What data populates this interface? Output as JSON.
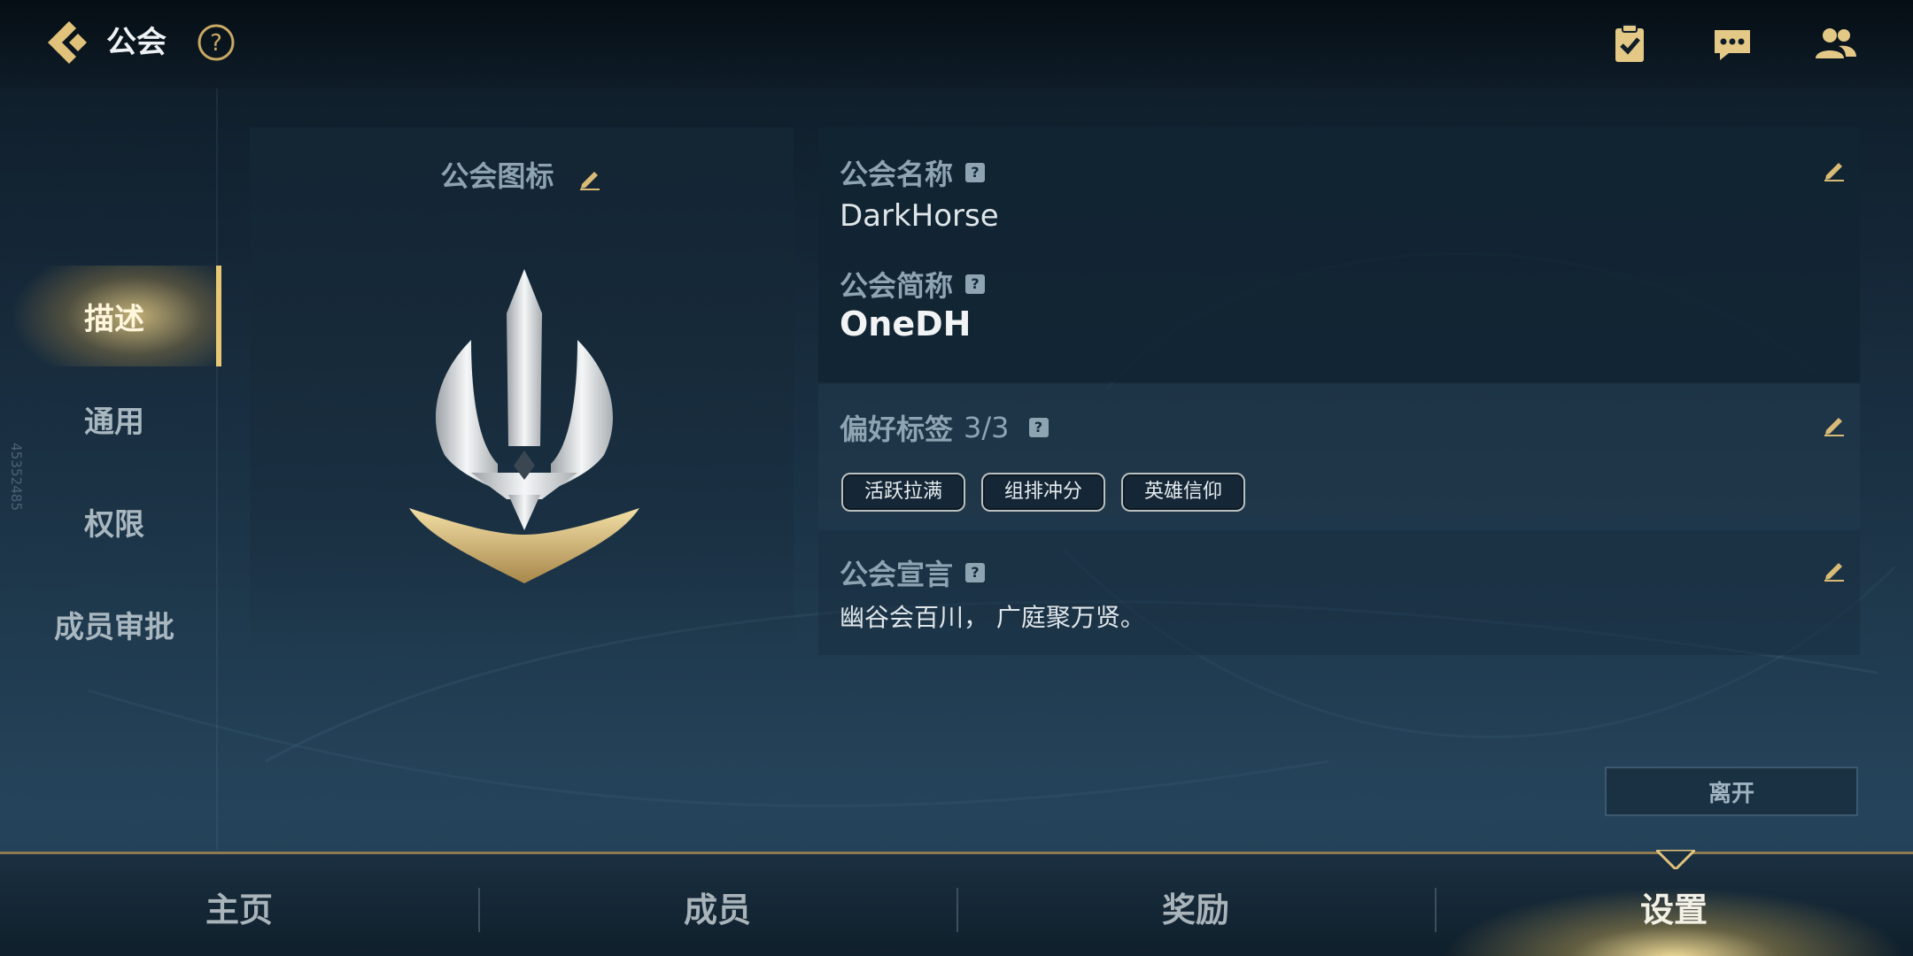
{
  "header": {
    "title": "公会",
    "icons": [
      "back-icon",
      "help-icon",
      "task-check-icon",
      "chat-icon",
      "friends-icon"
    ]
  },
  "side_nav": {
    "items": [
      {
        "label": "描述",
        "active": true
      },
      {
        "label": "通用",
        "active": false
      },
      {
        "label": "权限",
        "active": false
      },
      {
        "label": "成员审批",
        "active": false
      }
    ],
    "vertical_id": "45352485"
  },
  "emblem_panel": {
    "title": "公会图标"
  },
  "guild": {
    "name_label": "公会名称",
    "name": "DarkHorse",
    "short_label": "公会简称",
    "short_name": "OneDH",
    "tags_label": "偏好标签",
    "tags_count": "3/3",
    "tags": [
      "活跃拉满",
      "组排冲分",
      "英雄信仰"
    ],
    "motto_label": "公会宣言",
    "motto": "幽谷会百川， 广庭聚万贤。",
    "help_glyph": "?"
  },
  "actions": {
    "leave_label": "离开"
  },
  "bottom_tabs": [
    {
      "label": "主页",
      "active": false
    },
    {
      "label": "成员",
      "active": false
    },
    {
      "label": "奖励",
      "active": false
    },
    {
      "label": "设置",
      "active": true
    }
  ],
  "colors": {
    "accent_gold": "#e8c775",
    "label_blue_gray": "#8ea4b3",
    "panel_bg": "#122432"
  }
}
